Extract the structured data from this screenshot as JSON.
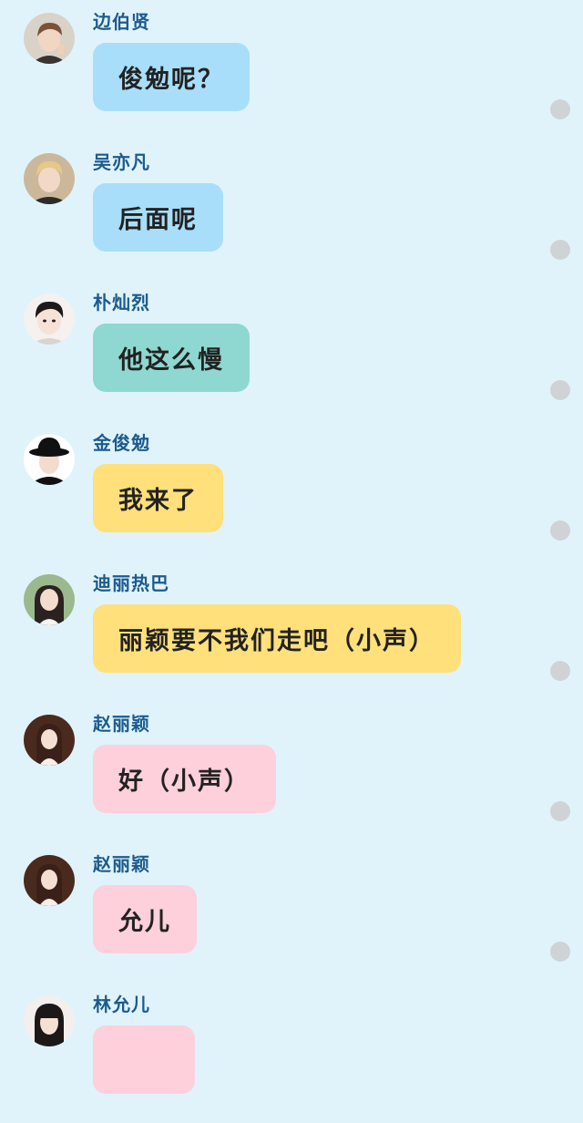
{
  "colors": {
    "background": "#e0f3fb",
    "sender_name": "#1c5b8e",
    "bubble_blue": "#a8def9",
    "bubble_teal": "#8fd8d1",
    "bubble_yellow": "#ffe07a",
    "bubble_pink": "#fdd0db",
    "unread_dot": "#cfd3d6"
  },
  "messages": [
    {
      "sender": "边伯贤",
      "text": "俊勉呢？",
      "bubble_color": "#a8def9",
      "avatar_icon": "avatar-boy-brown-hair-icon"
    },
    {
      "sender": "吴亦凡",
      "text": "后面呢",
      "bubble_color": "#a8def9",
      "avatar_icon": "avatar-boy-blond-hair-icon"
    },
    {
      "sender": "朴灿烈",
      "text": "他这么慢",
      "bubble_color": "#8fd8d1",
      "avatar_icon": "avatar-boy-dark-hair-icon"
    },
    {
      "sender": "金俊勉",
      "text": "我来了",
      "bubble_color": "#ffe07a",
      "avatar_icon": "avatar-boy-black-hat-icon"
    },
    {
      "sender": "迪丽热巴",
      "text": "丽颖要不我们走吧（小声）",
      "bubble_color": "#ffe07a",
      "avatar_icon": "avatar-girl-long-hair-icon"
    },
    {
      "sender": "赵丽颖",
      "text": "好（小声）",
      "bubble_color": "#fdd0db",
      "avatar_icon": "avatar-girl-dress-icon"
    },
    {
      "sender": "赵丽颖",
      "text": "允儿",
      "bubble_color": "#fdd0db",
      "avatar_icon": "avatar-girl-dress-icon"
    },
    {
      "sender": "林允儿",
      "text": "",
      "bubble_color": "#fdd0db",
      "avatar_icon": "avatar-girl-bangs-icon"
    }
  ]
}
